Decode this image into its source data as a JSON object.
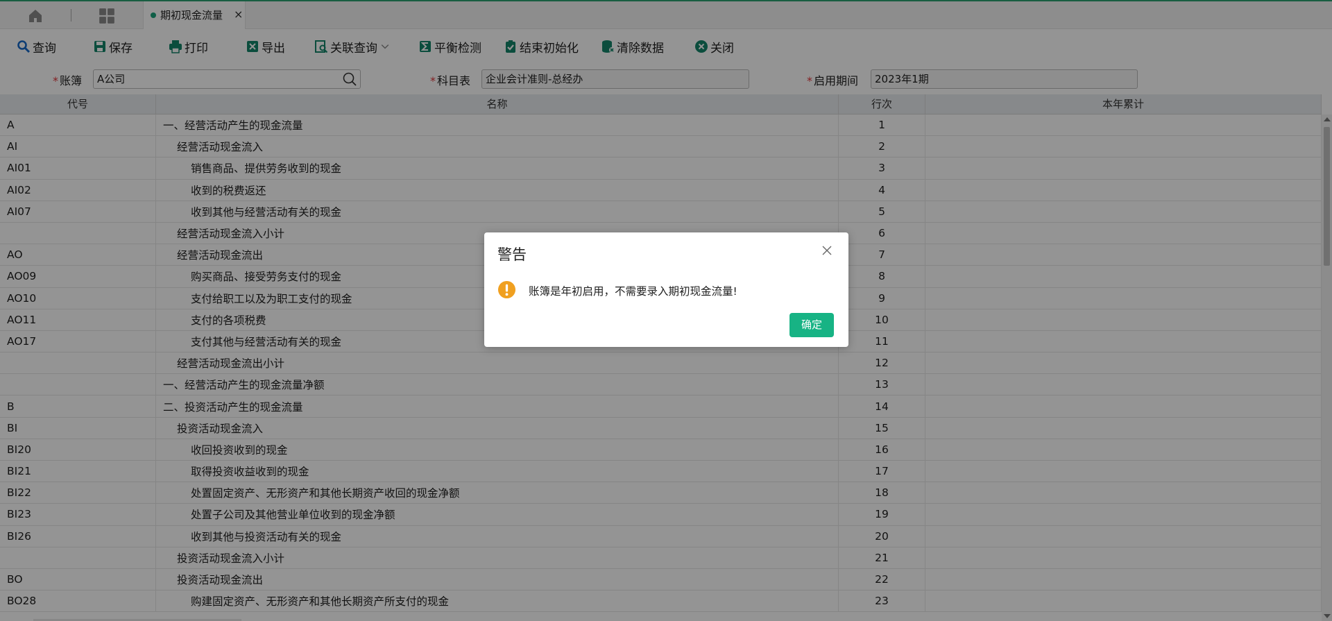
{
  "tabs": {
    "home_icon": "home-icon",
    "apps_icon": "grid-icon",
    "active_tab": {
      "label": "期初现金流量",
      "close": "×"
    }
  },
  "toolbar": {
    "query": "查询",
    "save": "保存",
    "print": "打印",
    "export": "导出",
    "related_query": "关联查询",
    "balance_check": "平衡检测",
    "finish_init": "结束初始化",
    "clear_data": "清除数据",
    "close": "关闭"
  },
  "filters": {
    "ledger": {
      "label": "账簿",
      "value": "A公司"
    },
    "subject_table": {
      "label": "科目表",
      "value": "企业会计准则-总经办"
    },
    "start_period": {
      "label": "启用期间",
      "value": "2023年1期"
    }
  },
  "table": {
    "headers": {
      "code": "代号",
      "name": "名称",
      "line": "行次",
      "ytd": "本年累计"
    },
    "rows": [
      {
        "code": "A",
        "name": "一、经营活动产生的现金流量",
        "level": 1,
        "line": "1"
      },
      {
        "code": "AI",
        "name": "经营活动现金流入",
        "level": 2,
        "line": "2"
      },
      {
        "code": "AI01",
        "name": "销售商品、提供劳务收到的现金",
        "level": 3,
        "line": "3"
      },
      {
        "code": "AI02",
        "name": "收到的税费返还",
        "level": 3,
        "line": "4"
      },
      {
        "code": "AI07",
        "name": "收到其他与经营活动有关的现金",
        "level": 3,
        "line": "5"
      },
      {
        "code": "",
        "name": "经营活动现金流入小计",
        "level": 2,
        "line": "6"
      },
      {
        "code": "AO",
        "name": "经营活动现金流出",
        "level": 2,
        "line": "7"
      },
      {
        "code": "AO09",
        "name": "购买商品、接受劳务支付的现金",
        "level": 3,
        "line": "8"
      },
      {
        "code": "AO10",
        "name": "支付给职工以及为职工支付的现金",
        "level": 3,
        "line": "9"
      },
      {
        "code": "AO11",
        "name": "支付的各项税费",
        "level": 3,
        "line": "10"
      },
      {
        "code": "AO17",
        "name": "支付其他与经营活动有关的现金",
        "level": 3,
        "line": "11"
      },
      {
        "code": "",
        "name": "经营活动现金流出小计",
        "level": 2,
        "line": "12"
      },
      {
        "code": "",
        "name": "一、经营活动产生的现金流量净额",
        "level": 1,
        "line": "13"
      },
      {
        "code": "B",
        "name": "二、投资活动产生的现金流量",
        "level": 1,
        "line": "14"
      },
      {
        "code": "BI",
        "name": "投资活动现金流入",
        "level": 2,
        "line": "15"
      },
      {
        "code": "BI20",
        "name": "收回投资收到的现金",
        "level": 3,
        "line": "16"
      },
      {
        "code": "BI21",
        "name": "取得投资收益收到的现金",
        "level": 3,
        "line": "17"
      },
      {
        "code": "BI22",
        "name": "处置固定资产、无形资产和其他长期资产收回的现金净额",
        "level": 3,
        "line": "18"
      },
      {
        "code": "BI23",
        "name": "处置子公司及其他营业单位收到的现金净额",
        "level": 3,
        "line": "19"
      },
      {
        "code": "BI26",
        "name": "收到其他与投资活动有关的现金",
        "level": 3,
        "line": "20"
      },
      {
        "code": "",
        "name": "投资活动现金流入小计",
        "level": 2,
        "line": "21"
      },
      {
        "code": "BO",
        "name": "投资活动现金流出",
        "level": 2,
        "line": "22"
      },
      {
        "code": "BO28",
        "name": "购建固定资产、无形资产和其他长期资产所支付的现金",
        "level": 3,
        "line": "23"
      }
    ]
  },
  "dialog": {
    "title": "警告",
    "message": "账簿是年初启用，不需要录入期初现金流量!",
    "ok": "确定"
  },
  "colors": {
    "accent": "#17b384",
    "required": "#e0353a",
    "warning": "#f0a020"
  }
}
